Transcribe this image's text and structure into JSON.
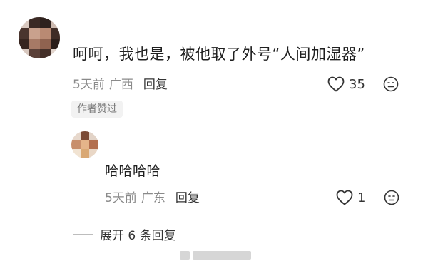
{
  "comment": {
    "text": "呵呵，我也是，被他取了外号“人间加湿器”",
    "time": "5天前",
    "location": "广西",
    "reply_label": "回复",
    "likes": "35",
    "badge": "作者赞过"
  },
  "reply": {
    "text": "哈哈哈哈",
    "time": "5天前",
    "location": "广东",
    "reply_label": "回复",
    "likes": "1"
  },
  "expand_label": "展开 6 条回复",
  "colors": {
    "meta_gray": "#8a8a8a",
    "text_dark": "#1f1f1f",
    "badge_bg": "#f2f2f2"
  }
}
